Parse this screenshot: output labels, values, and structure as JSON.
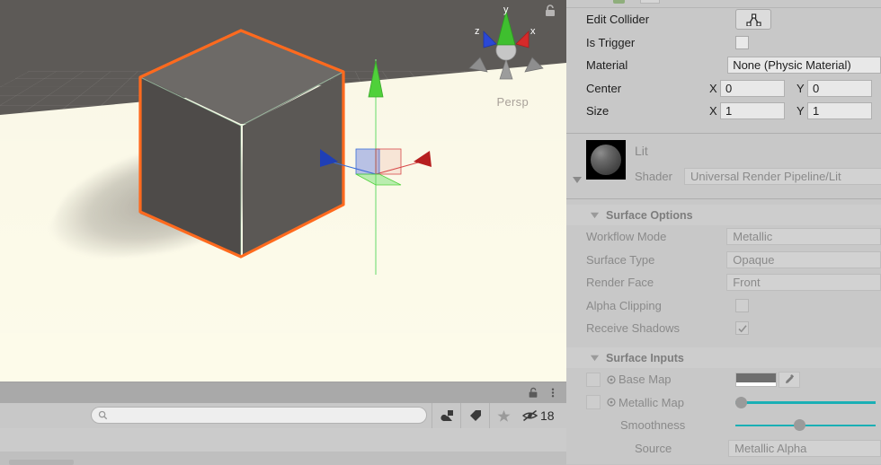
{
  "scene": {
    "viewport_label": "Persp",
    "gizmo_axes": [
      "y",
      "z",
      "x"
    ],
    "axis_colors": {
      "x": "#d93b3b",
      "y": "#5ec13b",
      "z": "#3b6fd9"
    },
    "selection_outline_color": "#ff6a1e",
    "lock_icon": "lock-open-icon"
  },
  "project_panel": {
    "lock_icon": "lock-open-icon",
    "menu_icon": "kebab-menu-icon",
    "search": {
      "value": "",
      "placeholder": "",
      "icon": "search-icon"
    },
    "toolbar_icons": [
      "shapes-filter-icon",
      "tag-filter-icon",
      "favorite-star-icon"
    ],
    "hidden_objects": {
      "icon": "eye-crossed-icon",
      "count": "18"
    }
  },
  "inspector": {
    "collider": {
      "edit_collider": {
        "label": "Edit Collider",
        "icon": "polygon-edit-icon"
      },
      "is_trigger": {
        "label": "Is Trigger",
        "checked": false
      },
      "material": {
        "label": "Material",
        "value": "None (Physic Material)"
      },
      "center": {
        "label": "Center",
        "x_axis": "X",
        "x": "0",
        "y_axis": "Y",
        "y": "0"
      },
      "size": {
        "label": "Size",
        "x_axis": "X",
        "x": "1",
        "y_axis": "Y",
        "y": "1"
      }
    },
    "material": {
      "name": "Lit",
      "shader_label": "Shader",
      "shader_value": "Universal Render Pipeline/Lit",
      "preview_icon": "material-sphere-preview"
    },
    "surface_options": {
      "title": "Surface Options",
      "workflow_mode": {
        "label": "Workflow Mode",
        "value": "Metallic"
      },
      "surface_type": {
        "label": "Surface Type",
        "value": "Opaque"
      },
      "render_face": {
        "label": "Render Face",
        "value": "Front"
      },
      "alpha_clipping": {
        "label": "Alpha Clipping",
        "checked": false
      },
      "receive_shadows": {
        "label": "Receive Shadows",
        "checked": true
      }
    },
    "surface_inputs": {
      "title": "Surface Inputs",
      "base_map": {
        "label": "Base Map",
        "color": "#6e6e6e",
        "picker_icon": "eyedropper-icon"
      },
      "metallic_map": {
        "label": "Metallic Map",
        "slider_value": 0
      },
      "smoothness": {
        "label": "Smoothness",
        "slider_value": 0.5
      },
      "source": {
        "label": "Source",
        "value": "Metallic Alpha"
      }
    },
    "accent_color": "#1aafb5"
  }
}
